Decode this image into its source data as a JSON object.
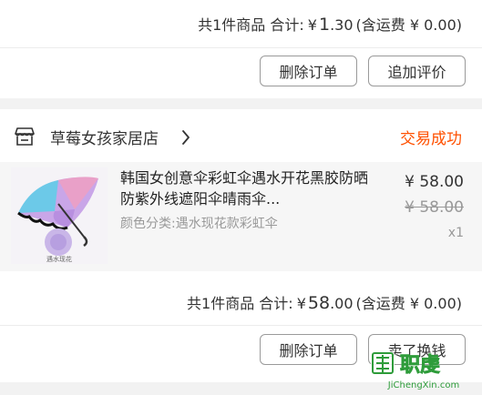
{
  "order1": {
    "summary": {
      "count_label": "共1件商品 合计:",
      "currency": "¥",
      "amount_int": "1",
      "amount_dec": ".30",
      "shipping": "(含运费 ¥ 0.00)"
    },
    "buttons": {
      "delete": "删除订单",
      "review": "追加评价"
    }
  },
  "order2": {
    "shop_name": "草莓女孩家居店",
    "status": "交易成功",
    "item": {
      "title": "韩国女创意伞彩虹伞遇水开花黑胶防晒防紫外线遮阳伞晴雨伞...",
      "sku": "颜色分类:遇水现花款彩虹伞",
      "price": "¥ 58.00",
      "original_price": "¥ 58.00",
      "quantity": "x1",
      "image_caption": "遇水现花"
    },
    "summary": {
      "count_label": "共1件商品 合计:",
      "currency": "¥",
      "amount_int": "58",
      "amount_dec": ".00",
      "shipping": "(含运费 ¥ 0.00)"
    },
    "buttons": {
      "delete": "删除订单",
      "sell": "卖了换钱"
    }
  },
  "watermark": {
    "site": "JiChengXin.com",
    "text": "职虔"
  },
  "colors": {
    "status": "#ff5000",
    "watermark_green": "#2e9c3a"
  }
}
